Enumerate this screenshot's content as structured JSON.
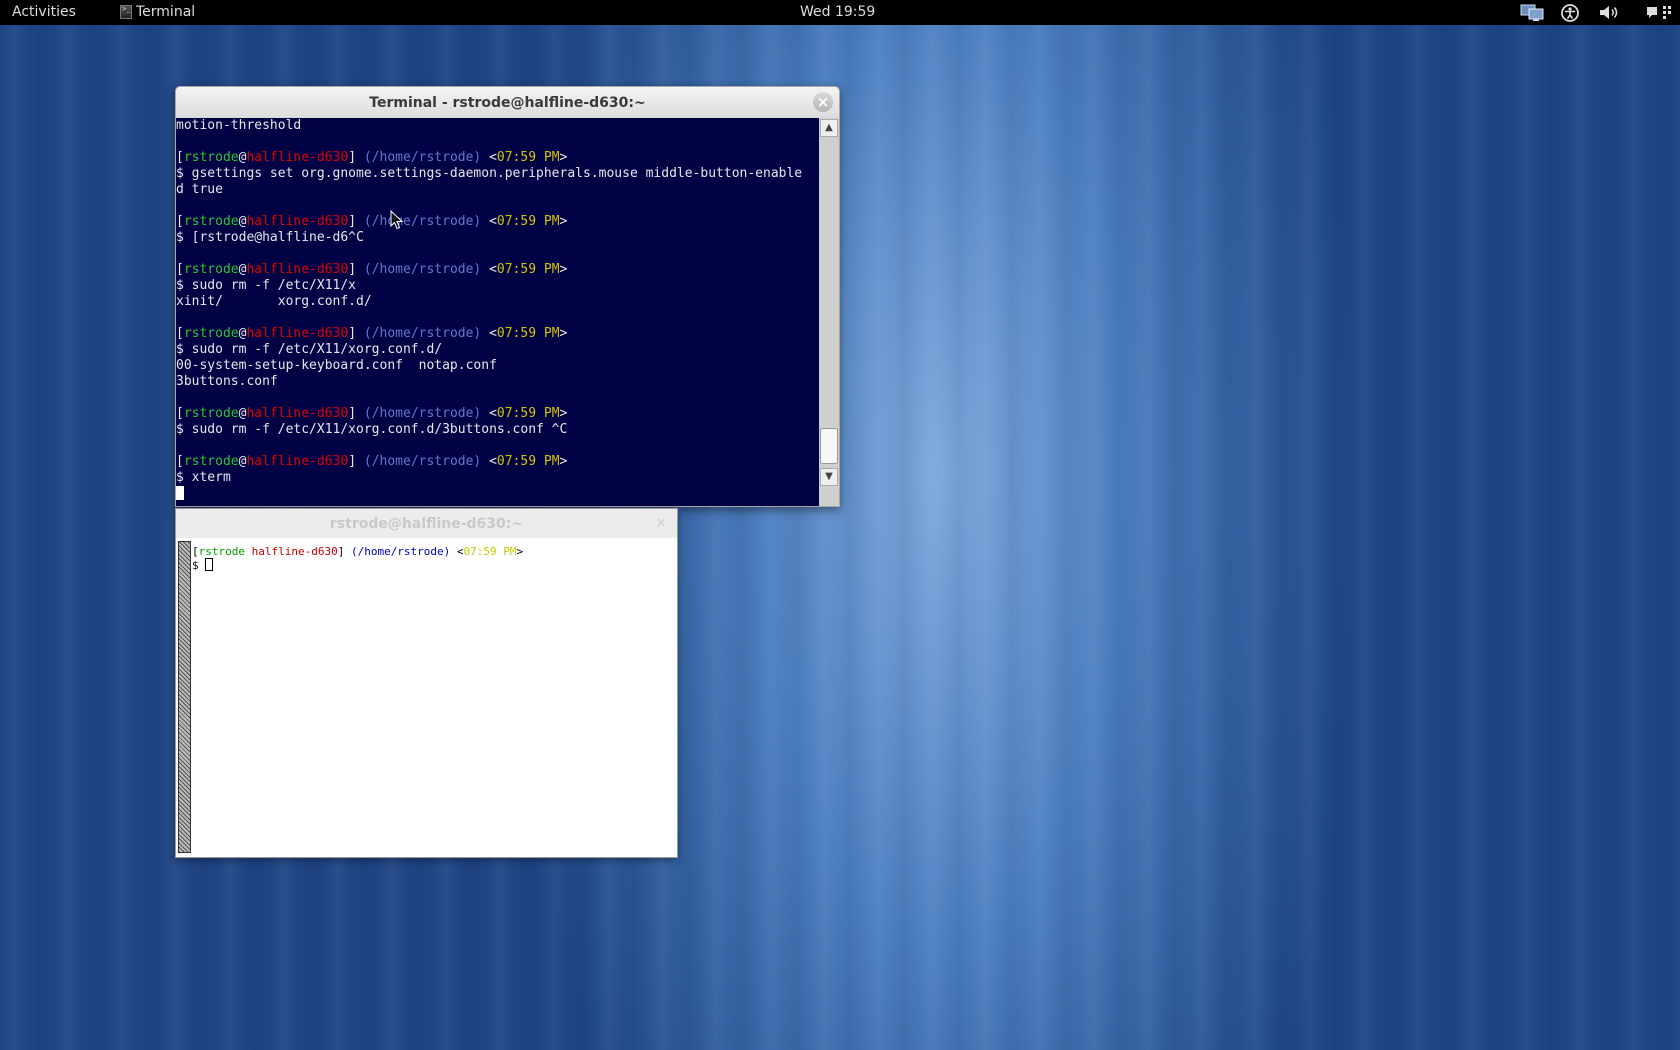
{
  "topbar": {
    "activities": "Activities",
    "app_name": "Terminal",
    "app_icon_glyph": ">_",
    "clock": "Wed 19:59",
    "tray_icons": [
      "network-icon",
      "accessibility-icon",
      "volume-icon",
      "chat-icon"
    ]
  },
  "gterm": {
    "title": "Terminal - rstrode@halfline-d630:~",
    "close": "×",
    "prompt": {
      "user": "rstrode",
      "at": "@",
      "host": "halfline-d630",
      "dir": "(/home/rstrode)",
      "time": "07:59 PM"
    },
    "lines": {
      "l1": "motion-threshold",
      "c1a": "$ gsettings set org.gnome.settings-daemon.peripherals.mouse middle-button-enable",
      "c1b": "d true",
      "c2": "$ [rstrode@halfline-d6^C",
      "c3": "$ sudo rm -f /etc/X11/x",
      "o3": "xinit/       xorg.conf.d/",
      "c4": "$ sudo rm -f /etc/X11/xorg.conf.d/",
      "o4a": "00-system-setup-keyboard.conf  notap.conf",
      "o4b": "3buttons.conf",
      "c5": "$ sudo rm -f /etc/X11/xorg.conf.d/3buttons.conf ^C",
      "c6": "$ xterm"
    },
    "scroll_up": "▲",
    "scroll_down": "▼"
  },
  "xterm": {
    "title": "rstrode@halfline-d630:~",
    "close": "×",
    "prompt": {
      "user": "rstrode",
      "host": "halfline-d630",
      "dir": "(/home/rstrode)",
      "time": "07:59 PM"
    },
    "cmd_prefix": "$ "
  },
  "colors": {
    "gterm_bg": "#000045",
    "user": "#2ec42e",
    "host": "#dd0000",
    "dir": "#5f79d3",
    "time": "#d6c500"
  }
}
